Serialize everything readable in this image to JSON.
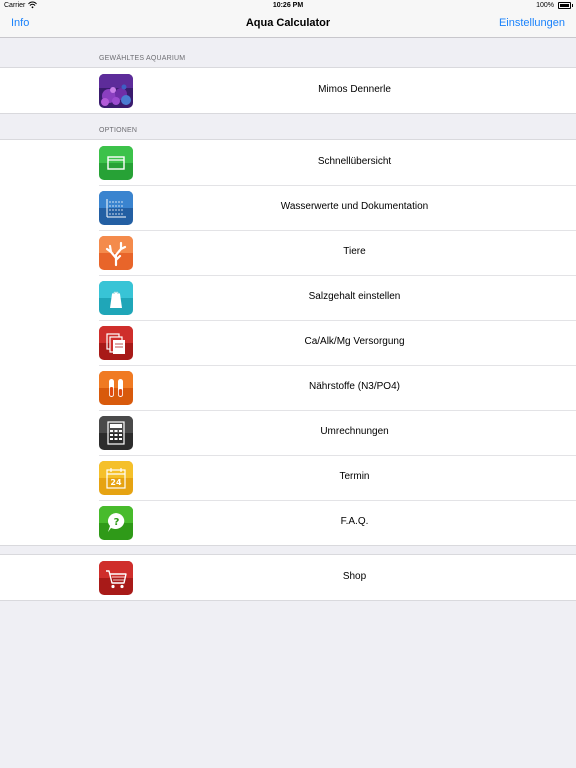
{
  "status": {
    "carrier": "Carrier",
    "time": "10:26 PM",
    "battery": "100%"
  },
  "nav": {
    "left": "Info",
    "title": "Aqua Calculator",
    "right": "Einstellungen"
  },
  "sections": {
    "aquarium_header": "GEWÄHLTES AQUARIUM",
    "options_header": "OPTIONEN"
  },
  "aquarium": {
    "label": "Mimos Dennerle",
    "icon": "aquarium-photo"
  },
  "options": [
    {
      "label": "Schnellübersicht",
      "icon": "overview-icon",
      "color": "#2db43c"
    },
    {
      "label": "Wasserwerte und Dokumentation",
      "icon": "water-values-icon",
      "color": "#2b6fb8"
    },
    {
      "label": "Tiere",
      "icon": "coral-icon",
      "color": "#f07a3c"
    },
    {
      "label": "Salzgehalt einstellen",
      "icon": "salt-shaker-icon",
      "color": "#27b7c9"
    },
    {
      "label": "Ca/Alk/Mg Versorgung",
      "icon": "documents-icon",
      "color": "#c0211f"
    },
    {
      "label": "Nährstoffe (N3/PO4)",
      "icon": "test-tubes-icon",
      "color": "#e86a12"
    },
    {
      "label": "Umrechnungen",
      "icon": "calculator-icon",
      "color": "#3a3a3a"
    },
    {
      "label": "Termin",
      "icon": "calendar-icon",
      "color": "#f0b418"
    },
    {
      "label": "F.A.Q.",
      "icon": "question-bubble-icon",
      "color": "#3aa820"
    }
  ],
  "shop": {
    "label": "Shop",
    "icon": "cart-icon",
    "color": "#c0211f"
  }
}
